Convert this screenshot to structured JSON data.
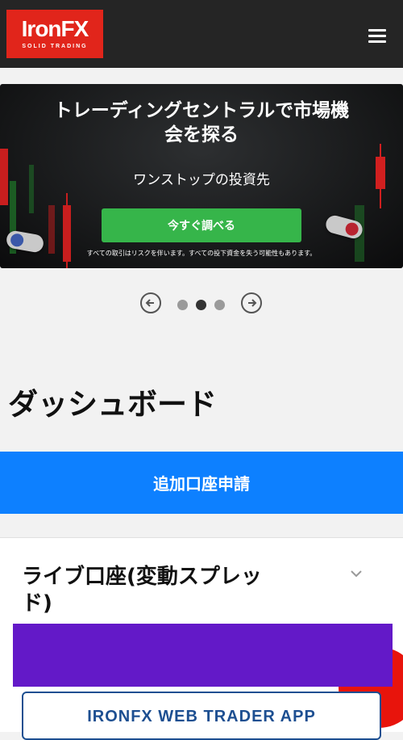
{
  "header": {
    "logo_text": "IronFX",
    "logo_tagline": "SOLID TRADING",
    "brand_color": "#e1251b",
    "menu_icon": "hamburger-menu-icon"
  },
  "banner": {
    "title": "トレーディングセントラルで市場機会を探る",
    "subtitle": "ワンストップの投資先",
    "cta_label": "今すぐ調べる",
    "disclaimer": "すべての取引はリスクを伴います。すべての投下資金を失う可能性もあります。",
    "cta_color": "#36b54a"
  },
  "carousel": {
    "prev_icon": "arrow-left-icon",
    "next_icon": "arrow-right-icon",
    "slide_count": 3,
    "active_index": 1
  },
  "page": {
    "title": "ダッシュボード"
  },
  "actions": {
    "add_account_label": "追加口座申請",
    "add_account_color": "#0d80ff"
  },
  "account": {
    "title": "ライブ口座(変動スプレッド)",
    "expand_icon": "chevron-down-icon",
    "webtrader_label": "IRONFX WEB TRADER APP"
  },
  "colors": {
    "redaction": "#6319c8",
    "fab": "#e8140c"
  }
}
